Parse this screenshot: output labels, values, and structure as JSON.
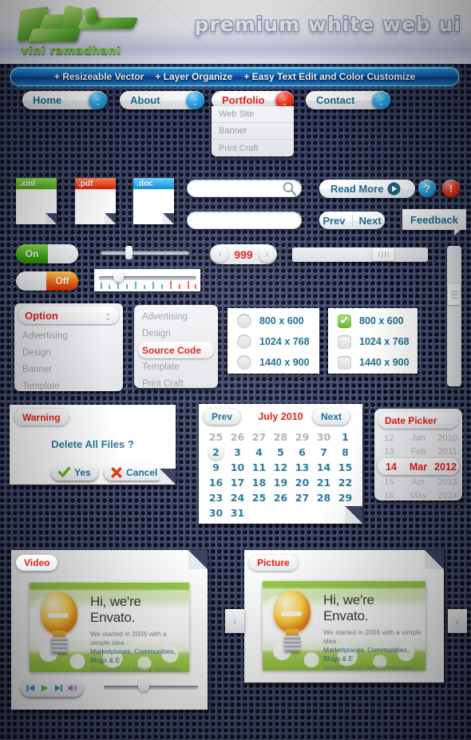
{
  "header": {
    "title": "premium white web ui",
    "logo_name": "vini ramadhani"
  },
  "feature_bar": {
    "items": [
      "+ Resizeable Vector",
      "+ Layer Organize",
      "+  Easy Text Edit and Color Customize"
    ]
  },
  "nav": {
    "items": [
      {
        "label": "Home",
        "state": "normal",
        "icon": "chevron-down-icon"
      },
      {
        "label": "About",
        "state": "normal",
        "icon": "chevron-down-icon"
      },
      {
        "label": "Portfolio",
        "state": "active",
        "icon": "chevron-down-icon"
      },
      {
        "label": "Contact",
        "state": "normal",
        "icon": "chevron-down-icon"
      }
    ],
    "dropdown": [
      "Web Site",
      "Banner",
      "Print Craft"
    ]
  },
  "files": [
    {
      "ext": ".xml",
      "color": "#64c52b"
    },
    {
      "ext": ".pdf",
      "color": "#e8341c"
    },
    {
      "ext": ".doc",
      "color": "#139ae0"
    }
  ],
  "search": {
    "value": "",
    "placeholder": "",
    "icon": "search-icon"
  },
  "text_field": {
    "value": "",
    "placeholder": ""
  },
  "buttons": {
    "read_more": "Read More",
    "read_more_icon": "play-circle-icon",
    "help": "?",
    "alert": "!",
    "prev": "Prev",
    "next": "Next",
    "feedback": "Feedback"
  },
  "toggles": [
    {
      "label": "On",
      "state": "on"
    },
    {
      "label": "Off",
      "state": "off"
    }
  ],
  "spinner": {
    "value": "999",
    "prev_icon": "chevron-left-icon",
    "next_icon": "chevron-right-icon"
  },
  "select_left": {
    "header": "Option",
    "icon": "chevron-down-icon",
    "items": [
      "Advertising",
      "Design",
      "Banner",
      "Template"
    ]
  },
  "select_right": {
    "items": [
      "Advertising",
      "Design",
      "Source Code",
      "Template",
      "Print Craft"
    ],
    "selected": "Source Code"
  },
  "radios": {
    "options": [
      "800 x 600",
      "1024 x 768",
      "1440 x 900"
    ],
    "selected": null
  },
  "checkboxes": {
    "options": [
      "800 x 600",
      "1024 x 768",
      "1440 x 900"
    ],
    "checked": [
      "800 x 600"
    ],
    "check_glyph": "✔"
  },
  "warning": {
    "badge": "Warning",
    "message": "Delete All Files ?",
    "yes": "Yes",
    "cancel": "Cancel",
    "yes_icon": "check-icon",
    "cancel_icon": "cross-icon"
  },
  "calendar": {
    "prev": "Prev",
    "next": "Next",
    "title": "July 2010",
    "today": "2",
    "cells": [
      {
        "d": "25",
        "m": true
      },
      {
        "d": "26",
        "m": true
      },
      {
        "d": "27",
        "m": true
      },
      {
        "d": "28",
        "m": true
      },
      {
        "d": "29",
        "m": true
      },
      {
        "d": "30",
        "m": true
      },
      {
        "d": "1",
        "m": false
      },
      {
        "d": "2",
        "m": false,
        "today": true
      },
      {
        "d": "3",
        "m": false
      },
      {
        "d": "4",
        "m": false
      },
      {
        "d": "5",
        "m": false
      },
      {
        "d": "6",
        "m": false
      },
      {
        "d": "7",
        "m": false
      },
      {
        "d": "8",
        "m": false
      },
      {
        "d": "9",
        "m": false
      },
      {
        "d": "10",
        "m": false
      },
      {
        "d": "11",
        "m": false
      },
      {
        "d": "12",
        "m": false
      },
      {
        "d": "13",
        "m": false
      },
      {
        "d": "14",
        "m": false
      },
      {
        "d": "15",
        "m": false
      },
      {
        "d": "16",
        "m": false
      },
      {
        "d": "17",
        "m": false
      },
      {
        "d": "18",
        "m": false
      },
      {
        "d": "19",
        "m": false
      },
      {
        "d": "20",
        "m": false
      },
      {
        "d": "21",
        "m": false
      },
      {
        "d": "22",
        "m": false
      },
      {
        "d": "23",
        "m": false
      },
      {
        "d": "24",
        "m": false
      },
      {
        "d": "25",
        "m": false
      },
      {
        "d": "26",
        "m": false
      },
      {
        "d": "27",
        "m": false
      },
      {
        "d": "28",
        "m": false
      },
      {
        "d": "29",
        "m": false
      },
      {
        "d": "30",
        "m": false
      },
      {
        "d": "31",
        "m": false
      },
      {
        "d": "",
        "m": false
      },
      {
        "d": "",
        "m": false
      },
      {
        "d": "",
        "m": false
      },
      {
        "d": "",
        "m": false
      },
      {
        "d": "",
        "m": false
      }
    ]
  },
  "date_picker": {
    "title": "Date Picker",
    "rows": [
      {
        "day": "12",
        "month": "Jan",
        "year": "2010",
        "sel": false
      },
      {
        "day": "13",
        "month": "Feb",
        "year": "2011",
        "sel": false
      },
      {
        "day": "14",
        "month": "Mar",
        "year": "2012",
        "sel": true
      },
      {
        "day": "15",
        "month": "Apr",
        "year": "2013",
        "sel": false
      },
      {
        "day": "16",
        "month": "May",
        "year": "2014",
        "sel": false
      }
    ]
  },
  "video": {
    "badge": "Video",
    "controls": [
      "prev-track-icon",
      "play-icon",
      "next-track-icon",
      "mute-icon"
    ],
    "slide": {
      "title": "Hi, we're Envato.",
      "line1": "We started in 2006 with a simple idea -",
      "line2": "Marketplaces, Communities, Blogs & E",
      "line3": "thousands of visitors everyday and are"
    }
  },
  "picture": {
    "badge": "Picture",
    "prev_icon": "chevron-left-icon",
    "next_icon": "chevron-right-icon",
    "slide": {
      "title": "Hi, we're Envato.",
      "line1": "We started in 2006 with a simple idea -",
      "line2": "Marketplaces, Communities, Blogs & E",
      "line3": "thousands of visitors everyday and are"
    }
  },
  "colors": {
    "accent_red": "#e41f14",
    "accent_blue": "#1d6e91",
    "bg": "#3b4463"
  }
}
